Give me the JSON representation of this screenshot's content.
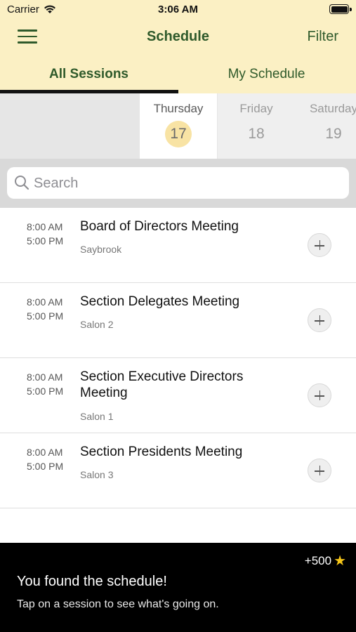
{
  "status_bar": {
    "carrier": "Carrier",
    "time": "3:06 AM"
  },
  "header": {
    "title": "Schedule",
    "filter_label": "Filter"
  },
  "tabs": [
    {
      "label": "All Sessions",
      "active": true
    },
    {
      "label": "My Schedule",
      "active": false
    }
  ],
  "days": [
    {
      "name": "Thursday",
      "number": "17",
      "selected": true
    },
    {
      "name": "Friday",
      "number": "18",
      "selected": false
    },
    {
      "name": "Saturday",
      "number": "19",
      "selected": false
    }
  ],
  "search": {
    "placeholder": "Search"
  },
  "sessions": [
    {
      "start": "8:00 AM",
      "end": "5:00 PM",
      "title": "Board of Directors Meeting",
      "room": "Saybrook"
    },
    {
      "start": "8:00 AM",
      "end": "5:00 PM",
      "title": "Section Delegates Meeting",
      "room": "Salon 2"
    },
    {
      "start": "8:00 AM",
      "end": "5:00 PM",
      "title": "Section Executive Directors Meeting",
      "room": "Salon 1"
    },
    {
      "start": "8:00 AM",
      "end": "5:00 PM",
      "title": "Section Presidents Meeting",
      "room": "Salon 3"
    }
  ],
  "toast": {
    "points": "+500",
    "title": "You found the schedule!",
    "subtitle": "Tap on a session to see what's going on."
  },
  "colors": {
    "header_bg": "#fbf0c4",
    "accent_green": "#2f5a2b",
    "selected_day_circle": "#f8e3a4",
    "star": "#f5c518"
  }
}
